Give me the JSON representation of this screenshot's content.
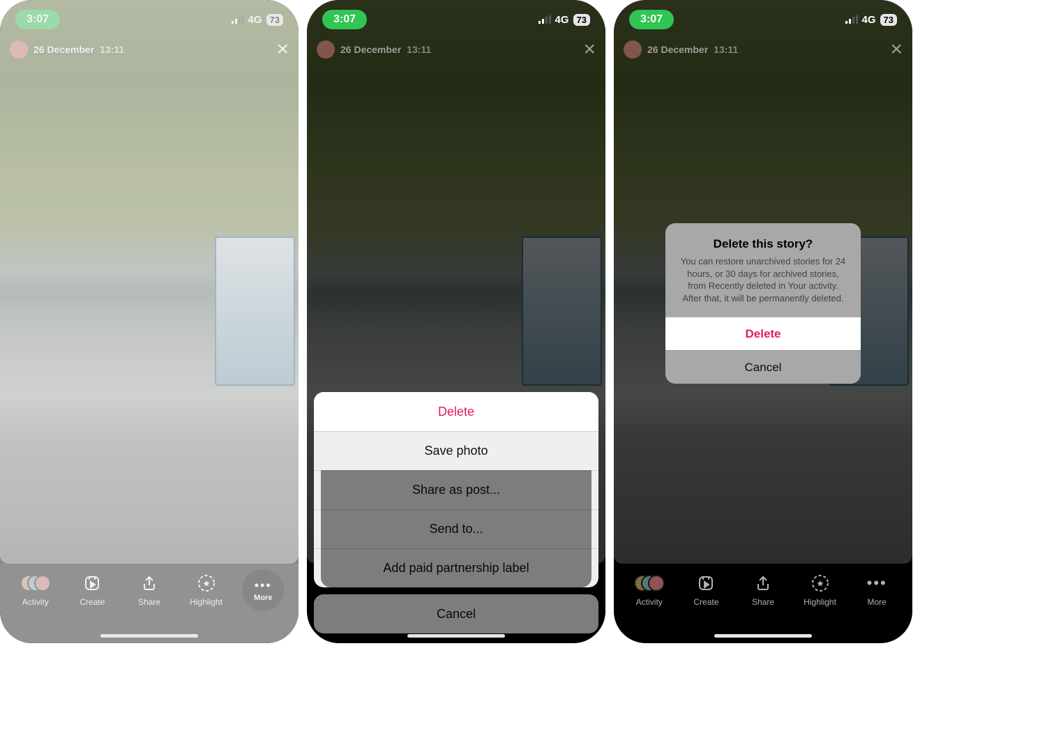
{
  "status": {
    "time": "3:07",
    "network": "4G",
    "battery": "73"
  },
  "story": {
    "date": "26 December",
    "time": "13:11"
  },
  "toolbar": {
    "activity": "Activity",
    "create": "Create",
    "share": "Share",
    "highlight": "Highlight",
    "more": "More"
  },
  "action_sheet": {
    "items": [
      {
        "label": "Delete",
        "destructive": true
      },
      {
        "label": "Save photo",
        "destructive": false
      },
      {
        "label": "Share as post...",
        "destructive": false
      },
      {
        "label": "Send to...",
        "destructive": false
      },
      {
        "label": "Add paid partnership label",
        "destructive": false
      }
    ],
    "cancel": "Cancel"
  },
  "alert": {
    "title": "Delete this story?",
    "message": "You can restore unarchived stories for 24 hours, or 30 days for archived stories, from Recently deleted in Your activity. After that, it will be permanently deleted.",
    "delete": "Delete",
    "cancel": "Cancel"
  }
}
